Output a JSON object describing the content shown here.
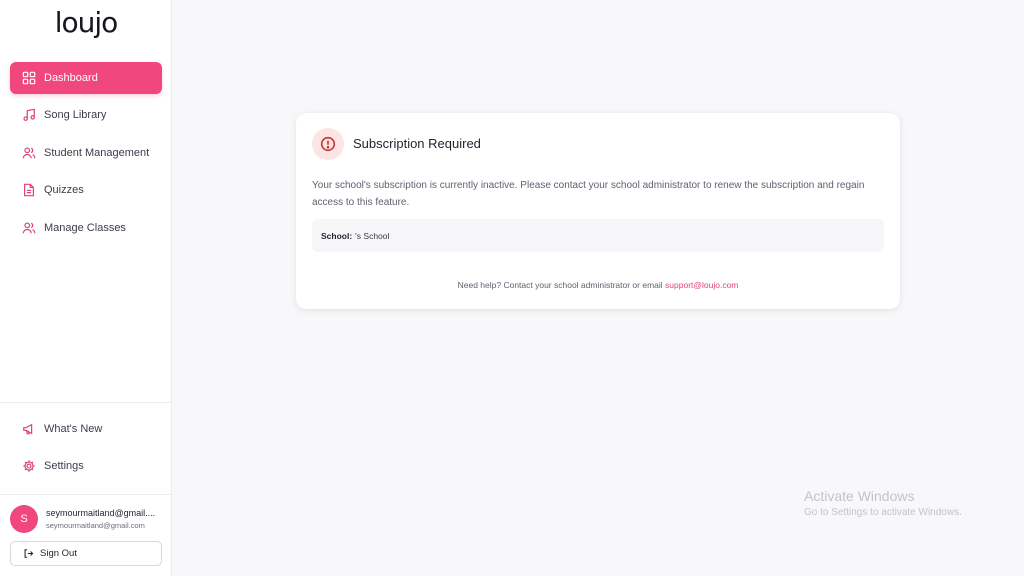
{
  "app": {
    "logo": "loujo"
  },
  "sidebar": {
    "items": [
      {
        "label": "Dashboard",
        "icon": "dashboard-grid-icon",
        "active": true
      },
      {
        "label": "Song Library",
        "icon": "music-note-icon"
      },
      {
        "label": "Student Management",
        "icon": "users-icon"
      },
      {
        "label": "Quizzes",
        "icon": "document-icon"
      },
      {
        "label": "Manage Classes",
        "icon": "users-icon"
      }
    ],
    "bottom_items": [
      {
        "label": "What's New",
        "icon": "megaphone-icon"
      },
      {
        "label": "Settings",
        "icon": "gear-icon"
      }
    ],
    "user": {
      "initial": "S",
      "name": "seymourmaitland@gmail....",
      "email": "seymourmaitland@gmail.com"
    },
    "sign_out_label": "Sign Out"
  },
  "main": {
    "card": {
      "title": "Subscription Required",
      "description": "Your school's subscription is currently inactive. Please contact your school administrator to renew the subscription and regain access to this feature.",
      "school_label": "School:",
      "school_value": "'s School",
      "help_text": "Need help? Contact your school administrator or email",
      "help_email": "support@loujo.com"
    }
  },
  "watermark": {
    "title": "Activate Windows",
    "subtitle": "Go to Settings to activate Windows."
  },
  "colors": {
    "accent": "#f0477d",
    "alert_bg": "#fde4e4",
    "alert_icon": "#c0392b",
    "link": "#e0457a"
  }
}
